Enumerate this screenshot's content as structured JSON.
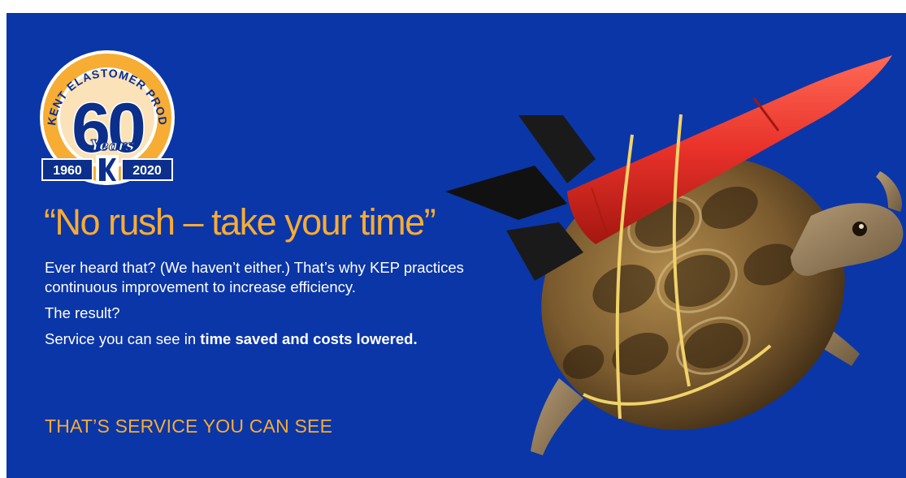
{
  "logo": {
    "ring_text": "KENT ELASTOMER PRODUCTS, INC.",
    "big_number": "60",
    "years_script": "Years",
    "year_start": "1960",
    "year_end": "2020"
  },
  "headline": "“No rush – take your time”",
  "body": {
    "paragraph1": "Ever heard that?  (We haven’t either.) That’s why KEP practices continuous improvement to increase efficiency.",
    "paragraph2": "The result?",
    "paragraph3_prefix": "Service you can see in ",
    "paragraph3_bold": "time saved and costs lowered."
  },
  "tagline": "THAT’S SERVICE YOU CAN SEE",
  "colors": {
    "banner_blue": "#0b36a8",
    "accent_orange": "#f7ac33",
    "text_white": "#ffffff",
    "rocket_red": "#e8312a"
  }
}
